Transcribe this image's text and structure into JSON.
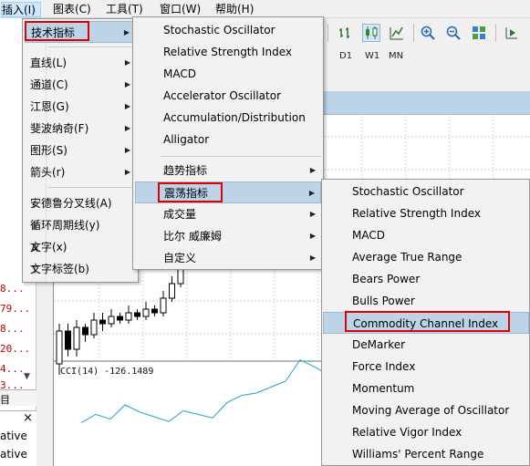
{
  "menubar": {
    "insert": "插入(I)",
    "chart": "图表(C)",
    "tools": "工具(T)",
    "window": "窗口(W)",
    "help": "帮助(H)"
  },
  "toolbar": {
    "timeframes": [
      "D1",
      "W1",
      "MN"
    ],
    "icons": [
      "bar-chart-icon",
      "candlestick-icon",
      "line-chart-icon",
      "zoom-in-icon",
      "zoom-out-icon",
      "tile-windows-icon",
      "auto-scroll-icon"
    ]
  },
  "left_quotes": [
    "8...",
    "79...",
    "8...",
    "20...",
    "4...",
    "3..."
  ],
  "left_bottom": {
    "close_glyph": "×",
    "rows": [
      "ative",
      "ative"
    ]
  },
  "insert_menu": {
    "items": [
      {
        "label": "技术指标",
        "has_submenu": true
      },
      {
        "label": "直线(L)",
        "has_submenu": true
      },
      {
        "label": "通道(C)",
        "has_submenu": true
      },
      {
        "label": "江恩(G)",
        "has_submenu": true
      },
      {
        "label": "斐波纳奇(F)",
        "has_submenu": true
      },
      {
        "label": "图形(S)",
        "has_submenu": true
      },
      {
        "label": "箭头(r)",
        "has_submenu": true
      },
      {
        "label": "安德鲁分叉线(A)",
        "has_submenu": false
      },
      {
        "label": "循环周期线(y)",
        "has_submenu": false
      },
      {
        "label": "文字(x)",
        "has_submenu": false
      },
      {
        "label": "文字标签(b)",
        "has_submenu": false
      }
    ]
  },
  "indicator_menu": {
    "items": [
      "Stochastic Oscillator",
      "Relative Strength Index",
      "MACD",
      "Accelerator Oscillator",
      "Accumulation/Distribution",
      "Alligator"
    ],
    "groups": [
      "趋势指标",
      "震荡指标",
      "成交量",
      "比尔 威廉姆",
      "自定义"
    ]
  },
  "oscillator_menu": {
    "items": [
      "Stochastic Oscillator",
      "Relative Strength Index",
      "MACD",
      "Average True Range",
      "Bears Power",
      "Bulls Power",
      "Commodity Channel Index",
      "DeMarker",
      "Force Index",
      "Momentum",
      "Moving Average of Oscillator",
      "Relative Vigor Index",
      "Williams' Percent Range"
    ],
    "selected": "Commodity Channel Index"
  },
  "chart": {
    "cci_label": "CCI(14) -126.1489",
    "accent": "#bcd3e8",
    "cci_color": "#1aa3d0",
    "highlight_color": "#e00000",
    "cci_points": [
      5,
      12,
      8,
      20,
      14,
      10,
      6,
      15,
      12,
      9,
      22,
      28,
      30,
      35,
      40,
      58,
      52,
      45,
      38,
      34,
      30,
      28,
      26,
      32,
      40,
      45,
      38,
      30,
      24,
      18,
      12,
      8
    ],
    "candles": [
      [
        -0.6,
        0.3,
        -0.9,
        0.5
      ],
      [
        0.3,
        -0.2,
        -0.4,
        0.5
      ],
      [
        -0.2,
        0.4,
        -0.4,
        0.6
      ],
      [
        0.4,
        0.2,
        0.0,
        0.5
      ],
      [
        0.2,
        0.6,
        0.1,
        0.8
      ],
      [
        0.6,
        0.5,
        0.3,
        0.8
      ],
      [
        0.5,
        0.7,
        0.4,
        0.9
      ],
      [
        0.7,
        0.6,
        0.5,
        0.8
      ],
      [
        0.6,
        0.8,
        0.5,
        1.0
      ],
      [
        0.8,
        0.7,
        0.6,
        0.9
      ],
      [
        0.7,
        0.9,
        0.6,
        1.1
      ],
      [
        0.9,
        0.8,
        0.7,
        1.0
      ],
      [
        0.8,
        1.2,
        0.7,
        1.4
      ],
      [
        1.2,
        1.6,
        1.1,
        1.8
      ],
      [
        1.6,
        2.6,
        1.5,
        3.0
      ],
      [
        2.6,
        3.2,
        2.4,
        3.6
      ]
    ]
  }
}
